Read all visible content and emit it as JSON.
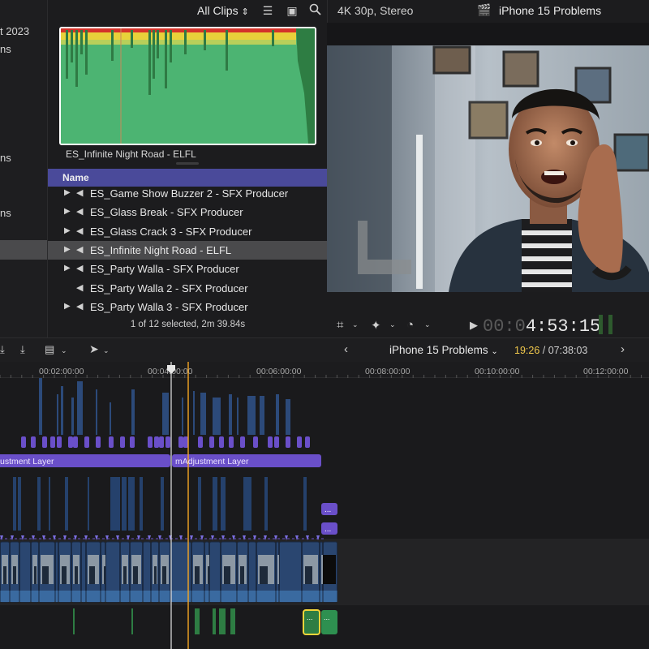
{
  "sidebar": {
    "items": [
      {
        "label": "t 2023"
      },
      {
        "label": "ns"
      },
      {
        "label": "ns"
      },
      {
        "label": "ns"
      }
    ]
  },
  "browser": {
    "filter_label": "All Clips",
    "icons": [
      "chevron-updown-icon",
      "clip-appearance-icon",
      "filmstrip-icon",
      "search-icon"
    ],
    "waveform_clip_name": "ES_Infinite Night Road - ELFL",
    "list_header": "Name",
    "clips": [
      {
        "name": "ES_Game Show Buzzer 2 - SFX Producer",
        "expandable": true,
        "selected": false
      },
      {
        "name": "ES_Glass Break - SFX Producer",
        "expandable": true,
        "selected": false
      },
      {
        "name": "ES_Glass Crack 3 - SFX Producer",
        "expandable": true,
        "selected": false
      },
      {
        "name": "ES_Infinite Night Road - ELFL",
        "expandable": true,
        "selected": true
      },
      {
        "name": "ES_Party Walla - SFX Producer",
        "expandable": true,
        "selected": false
      },
      {
        "name": "ES_Party Walla 2 - SFX Producer",
        "expandable": false,
        "selected": false
      },
      {
        "name": "ES_Party Walla 3 - SFX Producer",
        "expandable": true,
        "selected": false
      }
    ],
    "selection_status": "1 of 12 selected, 2m 39.84s"
  },
  "viewer": {
    "format": "4K 30p, Stereo",
    "project_title": "iPhone 15 Problems",
    "timecode_dim": "00:0",
    "timecode_bright": "4:53:15"
  },
  "timeline": {
    "project_name": "iPhone 15 Problems",
    "current_time": "19:26",
    "total_time": "/ 07:38:03",
    "ruler_ticks": [
      "00:02:00:00",
      "00:04:00:00",
      "00:06:00:00",
      "00:08:00:00",
      "00:10:00:00",
      "00:12:00:00"
    ],
    "adjustment_layers": [
      "ustment Layer",
      "mAdjustment Layer"
    ],
    "markers": [
      "...",
      "...",
      "...",
      "..."
    ]
  },
  "colors": {
    "accent": "#5c5cc4",
    "playhead": "#f5a623",
    "waveform_green": "#49b36e",
    "clip_blue": "#2c4a7a",
    "adjustment_purple": "#6a4fc9"
  }
}
